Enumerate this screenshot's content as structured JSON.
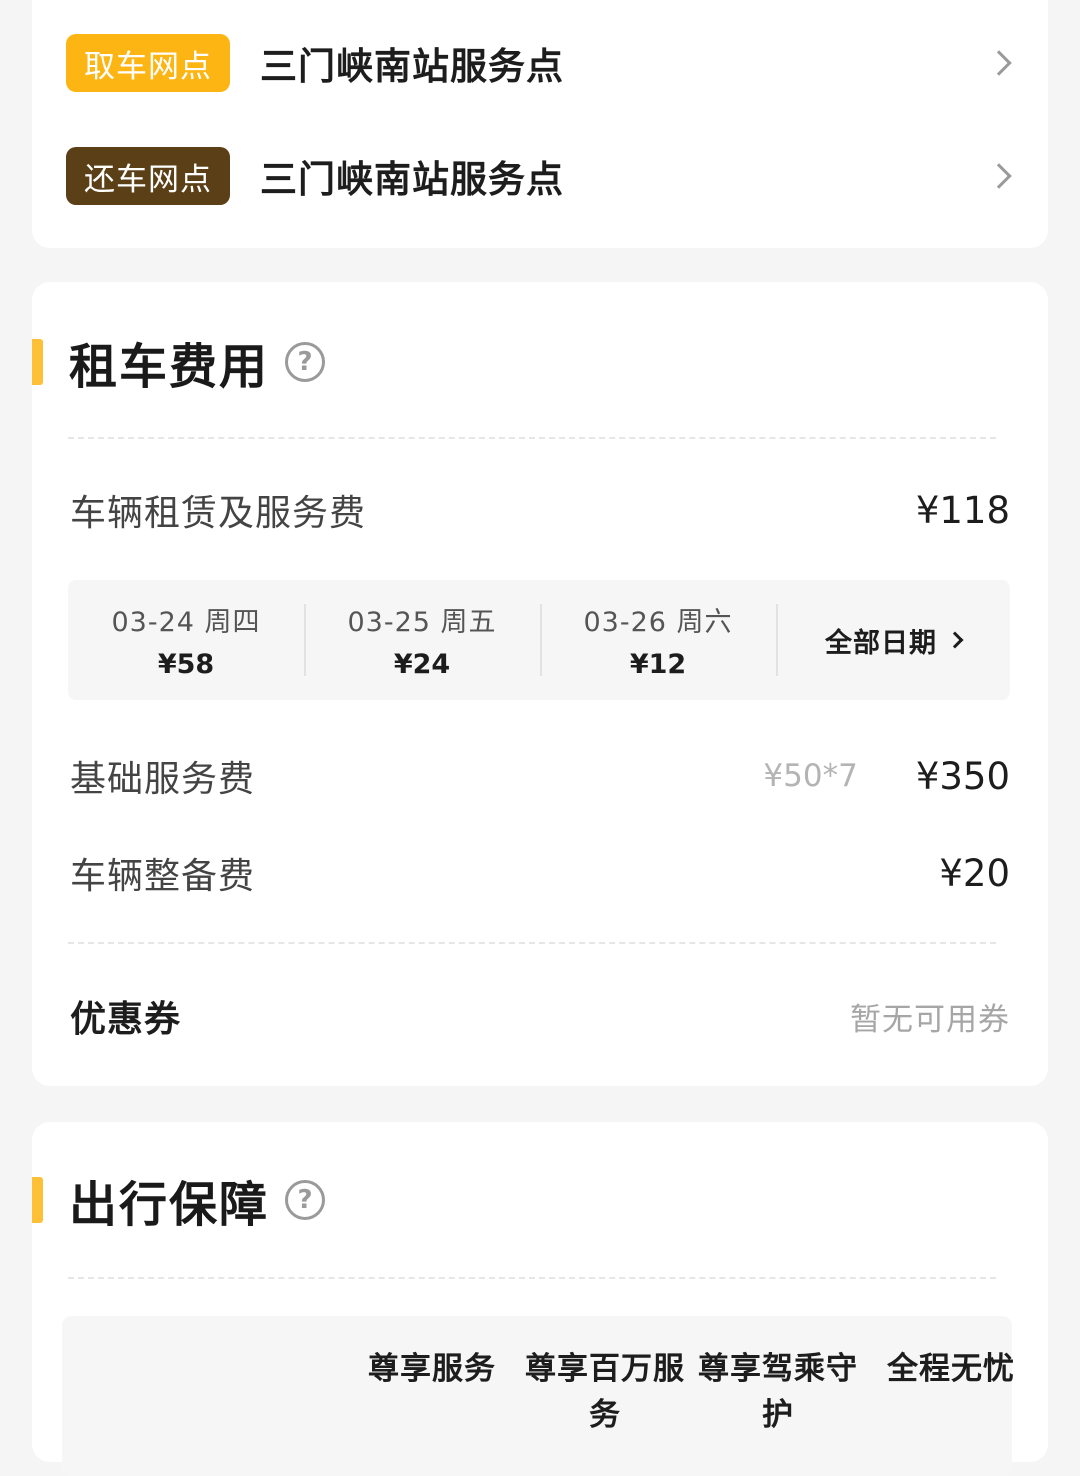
{
  "locations": {
    "pickup": {
      "tag": "取车网点",
      "name": "三门峡南站服务点"
    },
    "return": {
      "tag": "还车网点",
      "name": "三门峡南站服务点"
    }
  },
  "fees": {
    "title": "租车费用",
    "rental": {
      "label": "车辆租赁及服务费",
      "amount": "¥118"
    },
    "days": [
      {
        "date": "03-24 周四",
        "price": "¥58"
      },
      {
        "date": "03-25 周五",
        "price": "¥24"
      },
      {
        "date": "03-26 周六",
        "price": "¥12"
      }
    ],
    "all_dates_label": "全部日期",
    "base_service": {
      "label": "基础服务费",
      "formula": "¥50*7",
      "amount": "¥350"
    },
    "prep": {
      "label": "车辆整备费",
      "amount": "¥20"
    },
    "coupon": {
      "label": "优惠券",
      "value": "暂无可用券"
    }
  },
  "insurance": {
    "title": "出行保障",
    "columns": [
      "尊享服务",
      "尊享百万服务",
      "尊享驾乘守护",
      "全程无忧"
    ]
  },
  "colors": {
    "pickup_tag": "#fdb514",
    "return_tag": "#5a3f17",
    "accent": "#fdc036"
  },
  "icons": {
    "chevron": "chevron-right-icon",
    "help": "question-circle-icon"
  }
}
